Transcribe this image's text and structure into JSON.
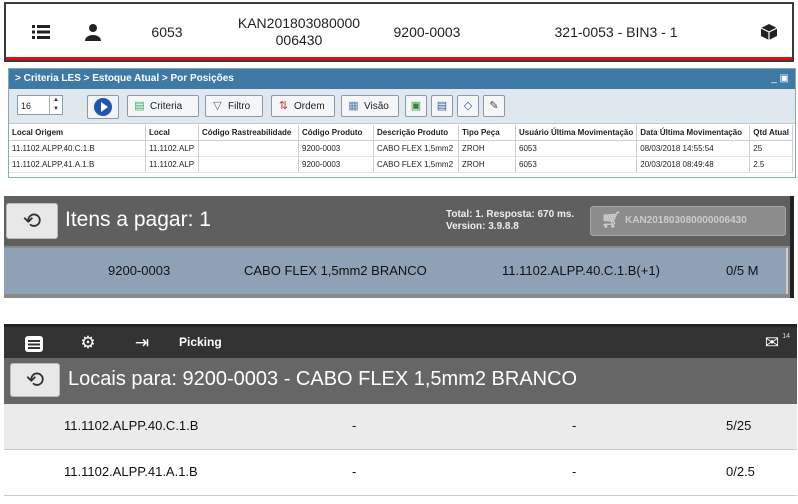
{
  "panel_top": {
    "code": "6053",
    "kanban": "KAN201803080000\n006430",
    "product": "9200-0003",
    "location": "321-0053 - BIN3 - 1",
    "icons": [
      "list-icon",
      "user-icon",
      "box-icon"
    ]
  },
  "panel_grid": {
    "breadcrumb": "> Criteria LES > Estoque Atual > Por Posições",
    "spin_value": "16",
    "buttons": {
      "criteria": "Criteria",
      "filtro": "Filtro",
      "ordem": "Ordem",
      "visao": "Visão"
    },
    "columns": [
      "Local Origem",
      "Local",
      "Código Rastreabilidade",
      "Código Produto",
      "Descrição Produto",
      "Tipo Peça",
      "Usuário Última Movimentação",
      "Data Última Movimentação",
      "Qtd Atual"
    ],
    "rows": [
      [
        "11.1102.ALPP.40.C.1.B",
        "11.1102.ALP",
        "",
        "9200-0003",
        "CABO FLEX 1,5mm2",
        "ZROH",
        "6053",
        "08/03/2018 14:55:54",
        "25"
      ],
      [
        "11.1102.ALPP.41.A.1.B",
        "11.1102.ALP",
        "",
        "9200-0003",
        "CABO FLEX 1,5mm2",
        "ZROH",
        "6053",
        "20/03/2018 08:49:48",
        "2.5"
      ]
    ]
  },
  "panel_pay": {
    "title": "Itens a pagar: 1",
    "meta_line1": "Total: 1. Resposta: 670 ms.",
    "meta_line2": "Version: 3.9.8.8",
    "cart_label": "KAN201803080000006430",
    "row": {
      "product": "9200-0003",
      "description": "CABO FLEX 1,5mm2 BRANCO",
      "location": "11.1102.ALPP.40.C.1.B(+1)",
      "qty": "0/5 M"
    }
  },
  "panel_pick": {
    "nav_label": "Picking",
    "badge": "14",
    "title": "Locais para: 9200-0003 - CABO FLEX 1,5mm2 BRANCO",
    "rows": [
      {
        "location": "11.1102.ALPP.40.C.1.B",
        "c2": "-",
        "c3": "-",
        "qty": "5/25"
      },
      {
        "location": "11.1102.ALPP.41.A.1.B",
        "c2": "-",
        "c3": "-",
        "qty": "0/2.5"
      }
    ]
  },
  "colors": {
    "titlebar": "#3f7aa6",
    "header_dark": "#5f5f5f",
    "row_selected": "#8fa1b4",
    "alert_red": "#dd1111"
  }
}
